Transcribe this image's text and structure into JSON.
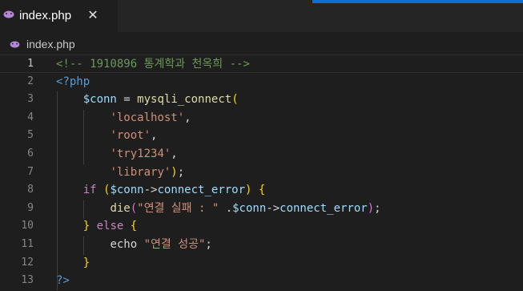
{
  "tab": {
    "filename": "index.php",
    "close_glyph": "✕",
    "icon": "php-elephant-icon",
    "icon_color": "#b886d8"
  },
  "breadcrumb": {
    "filename": "index.php",
    "icon": "php-elephant-icon"
  },
  "colors": {
    "background": "#1e1e1e",
    "comment": "#6a9955",
    "keyword": "#c586c0",
    "variable": "#9cdcfe",
    "function": "#dcdcaa",
    "string": "#ce9178",
    "php_tag": "#569cd6"
  },
  "editor": {
    "active_line": 1,
    "lines": [
      {
        "n": "1",
        "tokens": [
          {
            "t": "<!-- 1910896 통계학과 천옥희 -->",
            "c": "comment"
          }
        ]
      },
      {
        "n": "2",
        "tokens": [
          {
            "t": "<?php",
            "c": "php"
          }
        ]
      },
      {
        "n": "3",
        "tokens": [
          {
            "t": "    ",
            "c": "plain"
          },
          {
            "t": "$conn",
            "c": "var"
          },
          {
            "t": " = ",
            "c": "plain"
          },
          {
            "t": "mysqli_connect",
            "c": "func"
          },
          {
            "t": "(",
            "c": "brace"
          }
        ]
      },
      {
        "n": "4",
        "tokens": [
          {
            "t": "        ",
            "c": "plain"
          },
          {
            "t": "'localhost'",
            "c": "str"
          },
          {
            "t": ",",
            "c": "plain"
          }
        ]
      },
      {
        "n": "5",
        "tokens": [
          {
            "t": "        ",
            "c": "plain"
          },
          {
            "t": "'root'",
            "c": "str"
          },
          {
            "t": ",",
            "c": "plain"
          }
        ]
      },
      {
        "n": "6",
        "tokens": [
          {
            "t": "        ",
            "c": "plain"
          },
          {
            "t": "'try1234'",
            "c": "str"
          },
          {
            "t": ",",
            "c": "plain"
          }
        ]
      },
      {
        "n": "7",
        "tokens": [
          {
            "t": "        ",
            "c": "plain"
          },
          {
            "t": "'library'",
            "c": "str"
          },
          {
            "t": ")",
            "c": "brace"
          },
          {
            "t": ";",
            "c": "plain"
          }
        ]
      },
      {
        "n": "8",
        "tokens": [
          {
            "t": "    ",
            "c": "plain"
          },
          {
            "t": "if",
            "c": "kw"
          },
          {
            "t": " ",
            "c": "plain"
          },
          {
            "t": "(",
            "c": "brace"
          },
          {
            "t": "$conn",
            "c": "var"
          },
          {
            "t": "->",
            "c": "plain"
          },
          {
            "t": "connect_error",
            "c": "var"
          },
          {
            "t": ")",
            "c": "brace"
          },
          {
            "t": " ",
            "c": "plain"
          },
          {
            "t": "{",
            "c": "brace"
          }
        ]
      },
      {
        "n": "9",
        "tokens": [
          {
            "t": "        ",
            "c": "plain"
          },
          {
            "t": "die",
            "c": "func"
          },
          {
            "t": "(",
            "c": "brace2"
          },
          {
            "t": "\"연결 실패 : \"",
            "c": "str"
          },
          {
            "t": " .",
            "c": "plain"
          },
          {
            "t": "$conn",
            "c": "var"
          },
          {
            "t": "->",
            "c": "plain"
          },
          {
            "t": "connect_error",
            "c": "var"
          },
          {
            "t": ")",
            "c": "brace2"
          },
          {
            "t": ";",
            "c": "plain"
          }
        ]
      },
      {
        "n": "10",
        "tokens": [
          {
            "t": "    ",
            "c": "plain"
          },
          {
            "t": "}",
            "c": "brace"
          },
          {
            "t": " ",
            "c": "plain"
          },
          {
            "t": "else",
            "c": "kw"
          },
          {
            "t": " ",
            "c": "plain"
          },
          {
            "t": "{",
            "c": "brace"
          }
        ]
      },
      {
        "n": "11",
        "tokens": [
          {
            "t": "        ",
            "c": "plain"
          },
          {
            "t": "echo",
            "c": "plain"
          },
          {
            "t": " ",
            "c": "plain"
          },
          {
            "t": "\"연결 성공\"",
            "c": "str"
          },
          {
            "t": ";",
            "c": "plain"
          }
        ]
      },
      {
        "n": "12",
        "tokens": [
          {
            "t": "    ",
            "c": "plain"
          },
          {
            "t": "}",
            "c": "brace"
          }
        ]
      },
      {
        "n": "13",
        "tokens": [
          {
            "t": "?>",
            "c": "php"
          }
        ]
      }
    ]
  }
}
